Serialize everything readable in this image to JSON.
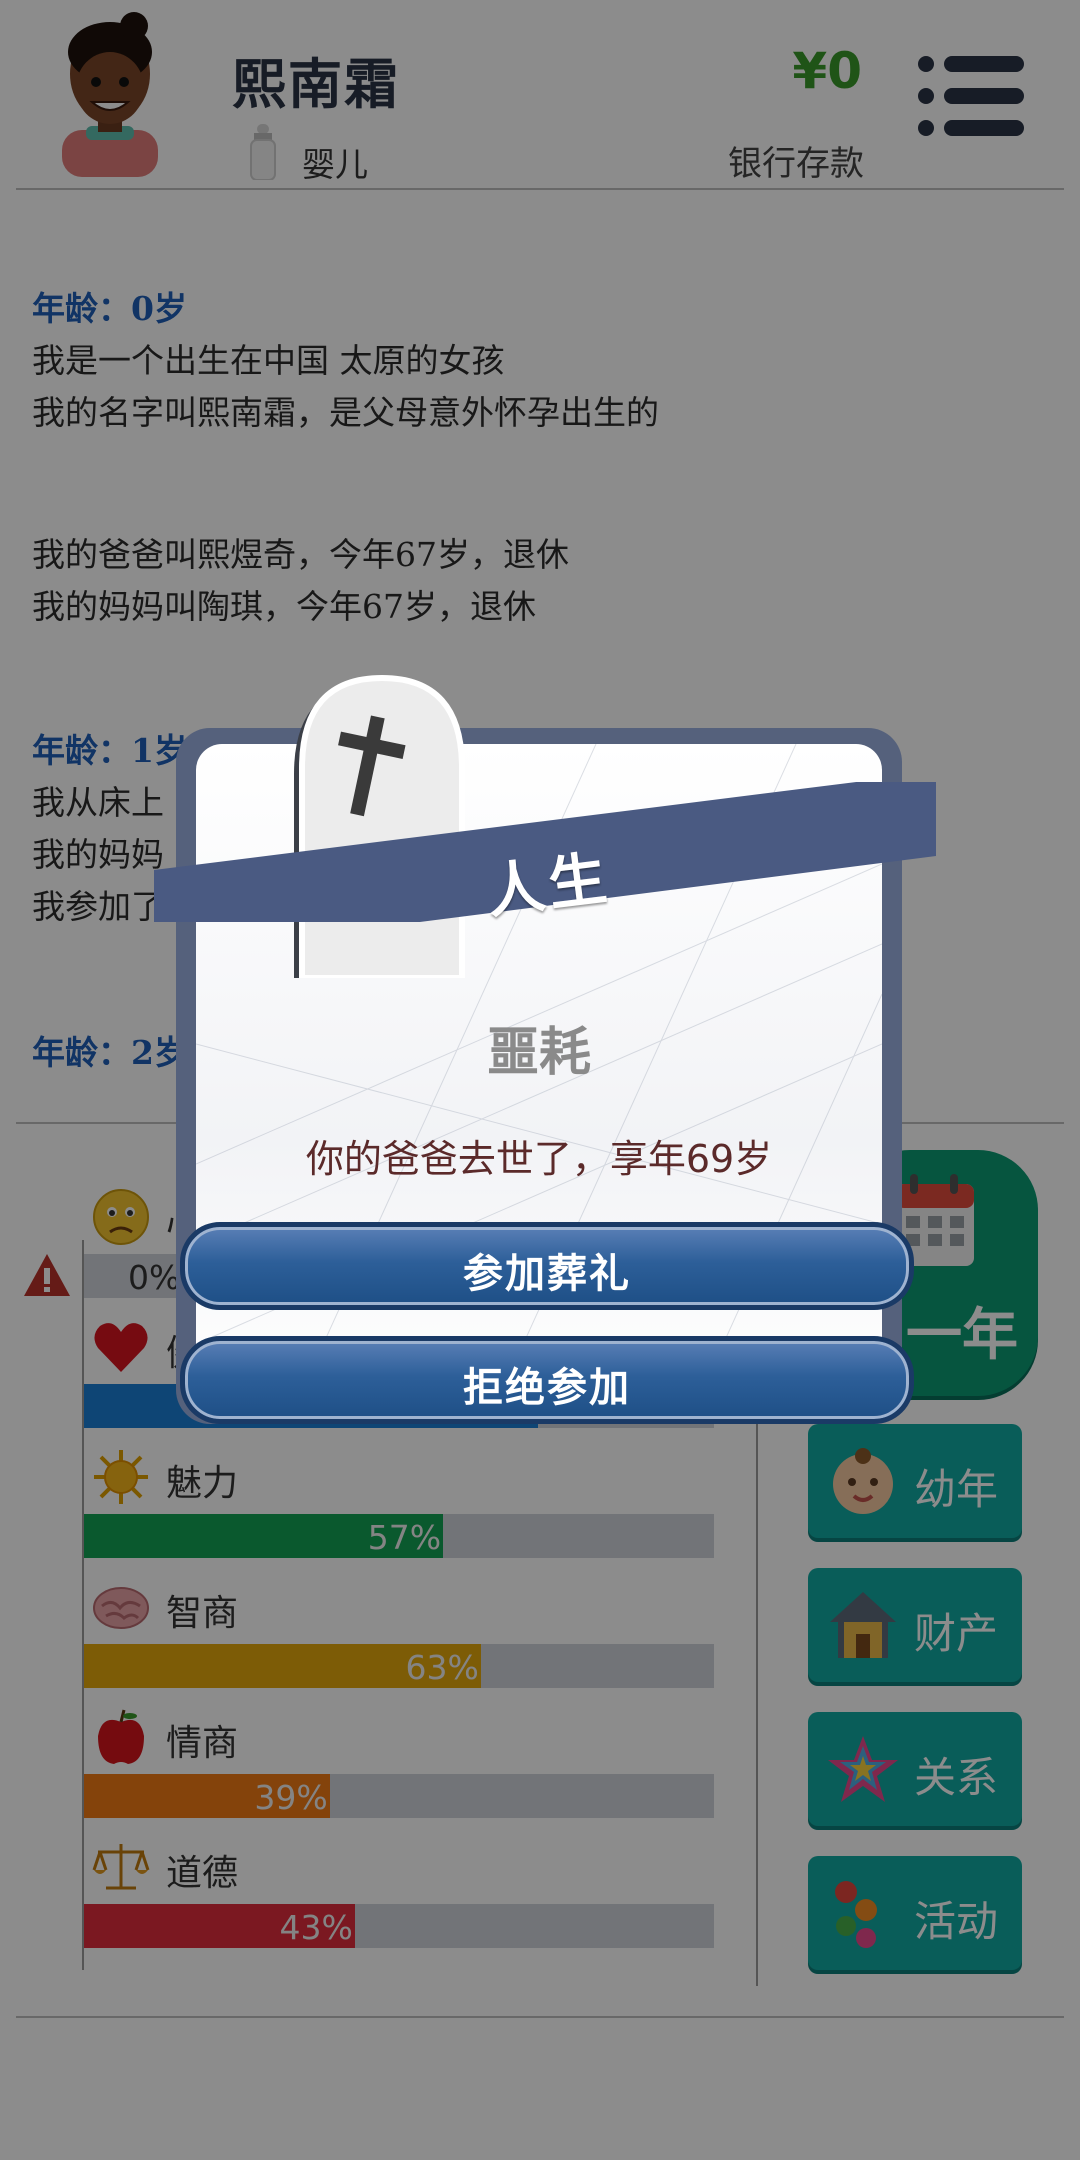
{
  "header": {
    "name": "熙南霜",
    "stage": "婴儿",
    "money": "¥0",
    "bank_label": "银行存款"
  },
  "log": {
    "entries": [
      {
        "age": "年龄：0岁"
      },
      {
        "line": "我是一个出生在中国 太原的女孩"
      },
      {
        "line": "我的名字叫熙南霜，是父母意外怀孕出生的"
      },
      {
        "line": "我的爸爸叫熙煜奇，今年67岁，退休"
      },
      {
        "line": "我的妈妈叫陶琪，今年67岁，退休"
      },
      {
        "age": "年龄：1岁"
      },
      {
        "line": "我从床上"
      },
      {
        "line": "我的妈妈"
      },
      {
        "line": "我参加了"
      },
      {
        "age": "年龄：2岁"
      }
    ]
  },
  "stats": [
    {
      "name": "心情",
      "percent": 0,
      "label": "0%",
      "color": "#4e8fcf",
      "icon": "sad-face-icon"
    },
    {
      "name": "健康",
      "percent": 72,
      "label": "",
      "color": "#1a7fd6",
      "icon": "heart-icon"
    },
    {
      "name": "魅力",
      "percent": 57,
      "label": "57%",
      "color": "#13a354",
      "icon": "sun-icon"
    },
    {
      "name": "智商",
      "percent": 63,
      "label": "63%",
      "color": "#e3a80c",
      "icon": "brain-icon"
    },
    {
      "name": "情商",
      "percent": 39,
      "label": "39%",
      "color": "#f07a14",
      "icon": "apple-icon"
    },
    {
      "name": "道德",
      "percent": 43,
      "label": "43%",
      "color": "#e02c3c",
      "icon": "scales-icon"
    }
  ],
  "side_buttons": {
    "next_year": "一年",
    "childhood": "幼年",
    "assets": "财产",
    "relations": "关系",
    "activities": "活动"
  },
  "dialog": {
    "banner": "人生",
    "title": "噩耗",
    "message": "你的爸爸去世了，享年69岁",
    "attend_button": "参加葬礼",
    "decline_button": "拒绝参加"
  },
  "colors": {
    "accent_green": "#3a9a2a",
    "age_button": "#0c9b74",
    "side_button": "#12a9a2",
    "banner": "#4a5a82"
  }
}
